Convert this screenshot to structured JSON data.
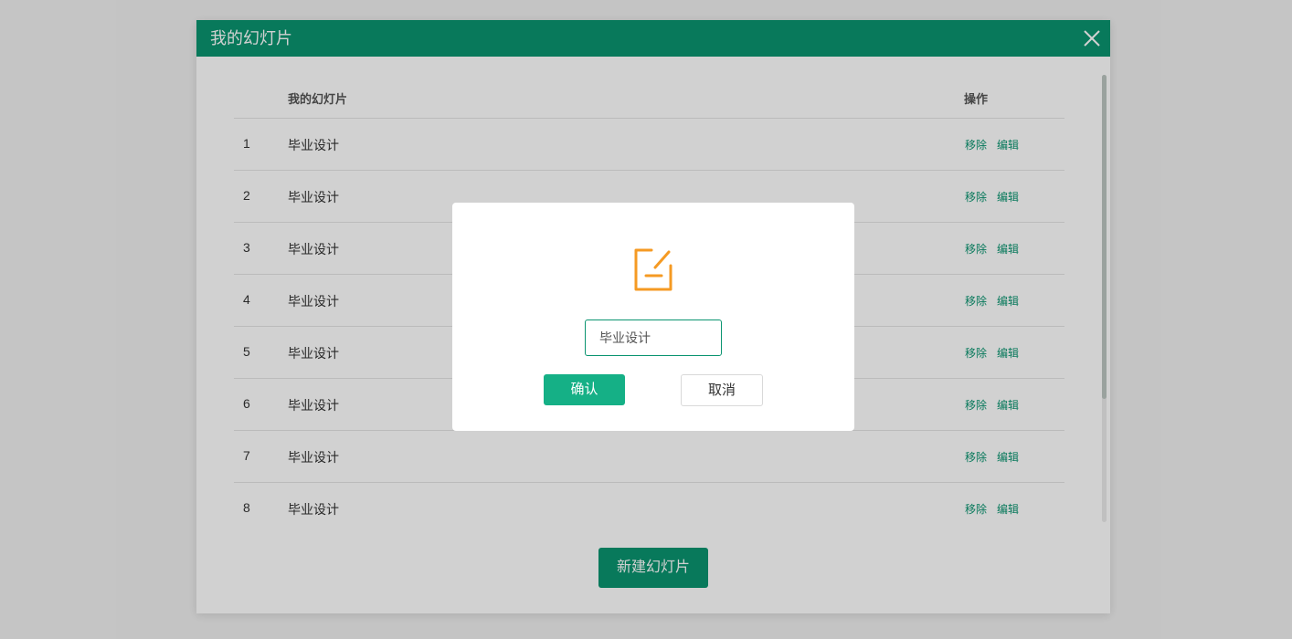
{
  "panel": {
    "title": "我的幻灯片",
    "close_icon": "close-icon"
  },
  "table": {
    "headers": {
      "name": "我的幻灯片",
      "ops": "操作"
    },
    "rows": [
      {
        "index": "1",
        "name": "毕业设计",
        "remove": "移除",
        "edit": "编辑"
      },
      {
        "index": "2",
        "name": "毕业设计",
        "remove": "移除",
        "edit": "编辑"
      },
      {
        "index": "3",
        "name": "毕业设计",
        "remove": "移除",
        "edit": "编辑"
      },
      {
        "index": "4",
        "name": "毕业设计",
        "remove": "移除",
        "edit": "编辑"
      },
      {
        "index": "5",
        "name": "毕业设计",
        "remove": "移除",
        "edit": "编辑"
      },
      {
        "index": "6",
        "name": "毕业设计",
        "remove": "移除",
        "edit": "编辑"
      },
      {
        "index": "7",
        "name": "毕业设计",
        "remove": "移除",
        "edit": "编辑"
      },
      {
        "index": "8",
        "name": "毕业设计",
        "remove": "移除",
        "edit": "编辑"
      }
    ]
  },
  "new_button": "新建幻灯片",
  "dialog": {
    "icon": "edit-icon",
    "input_value": "毕业设计",
    "confirm": "确认",
    "cancel": "取消"
  },
  "colors": {
    "primary": "#0a9470",
    "confirm": "#15b086",
    "icon": "#f59a23"
  }
}
